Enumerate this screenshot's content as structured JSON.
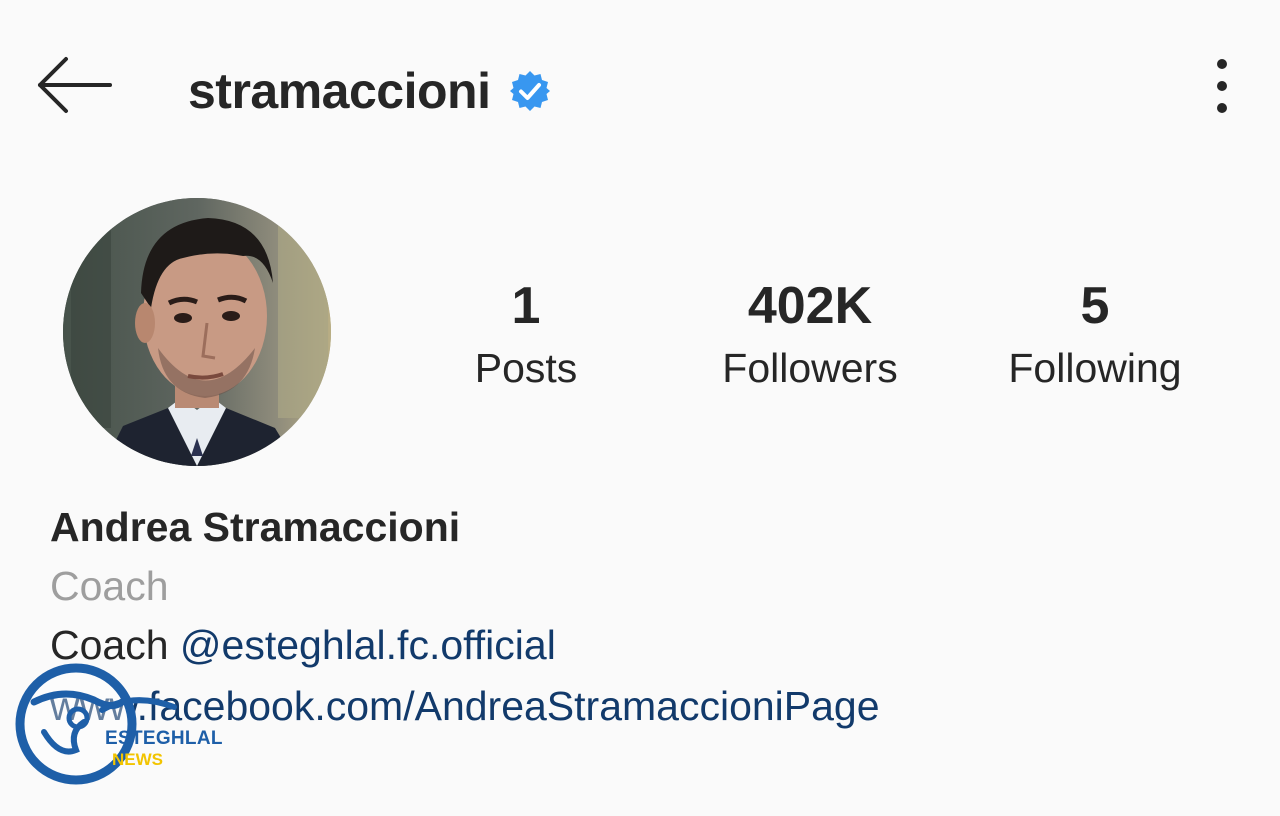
{
  "header": {
    "username": "stramaccioni",
    "verified": true,
    "back_icon": "arrow-left-icon",
    "more_icon": "more-vertical-icon",
    "verified_color": "#3897f0"
  },
  "stats": {
    "posts": {
      "value": "1",
      "label": "Posts"
    },
    "followers": {
      "value": "402K",
      "label": "Followers"
    },
    "following": {
      "value": "5",
      "label": "Following"
    }
  },
  "profile": {
    "full_name": "Andrea Stramaccioni",
    "category": "Coach",
    "bio_prefix": "Coach",
    "bio_mention": "@esteghlal.fc.official",
    "website": "www.facebook.com/AndreaStramaccioniPage",
    "link_color": "#123a6b"
  },
  "watermark": {
    "title": "ESTEGHLAL",
    "subtitle": "NEWS"
  }
}
